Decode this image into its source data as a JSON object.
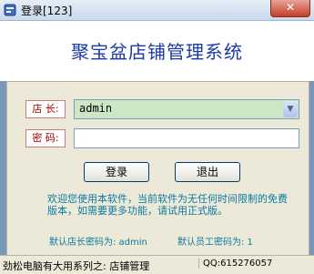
{
  "window": {
    "title": "登录[123]",
    "close_label": "✕"
  },
  "banner": {
    "title": "聚宝盆店铺管理系统"
  },
  "form": {
    "manager_label": "店 长:",
    "manager_value": "admin",
    "password_label": "密 码:",
    "password_value": ""
  },
  "buttons": {
    "login": "登录",
    "exit": "退出"
  },
  "notice": "欢迎您使用本软件，当前软件为无任何时间限制的免费版本，如需要更多功能，请试用正式版。",
  "defaults": {
    "manager_pwd": "默认店长密码为: admin",
    "staff_pwd": "默认员工密码为: 1"
  },
  "status": {
    "left": "劲松电脑有大用系列之: 店铺管理",
    "right": "QQ:615276057"
  },
  "colors": {
    "accent": "#1b3aa8",
    "notice": "#0a7aa0",
    "label": "#a00000"
  }
}
